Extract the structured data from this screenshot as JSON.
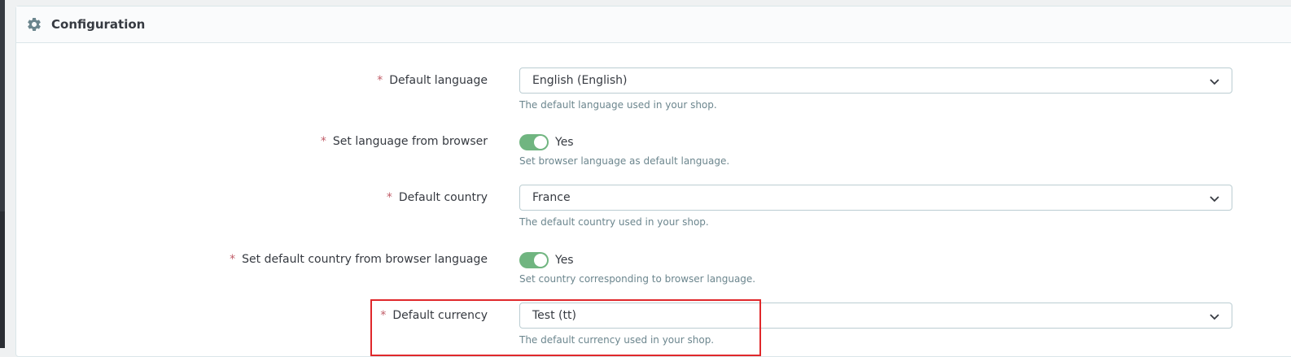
{
  "panel": {
    "title": "Configuration",
    "icon": "gear-icon"
  },
  "fields": {
    "default_language": {
      "required_mark": "*",
      "label": "Default language",
      "value": "English (English)",
      "help": "The default language used in your shop."
    },
    "language_from_browser": {
      "required_mark": "*",
      "label": "Set language from browser",
      "state_label": "Yes",
      "enabled": true,
      "help": "Set browser language as default language."
    },
    "default_country": {
      "required_mark": "*",
      "label": "Default country",
      "value": "France",
      "help": "The default country used in your shop."
    },
    "country_from_browser": {
      "required_mark": "*",
      "label": "Set default country from browser language",
      "state_label": "Yes",
      "enabled": true,
      "help": "Set country corresponding to browser language."
    },
    "default_currency": {
      "required_mark": "*",
      "label": "Default currency",
      "value": "Test (tt)",
      "help": "The default currency used in your shop."
    }
  },
  "colors": {
    "toggle_on": "#70b580",
    "required": "#c05c67",
    "highlight": "#e0282b"
  }
}
